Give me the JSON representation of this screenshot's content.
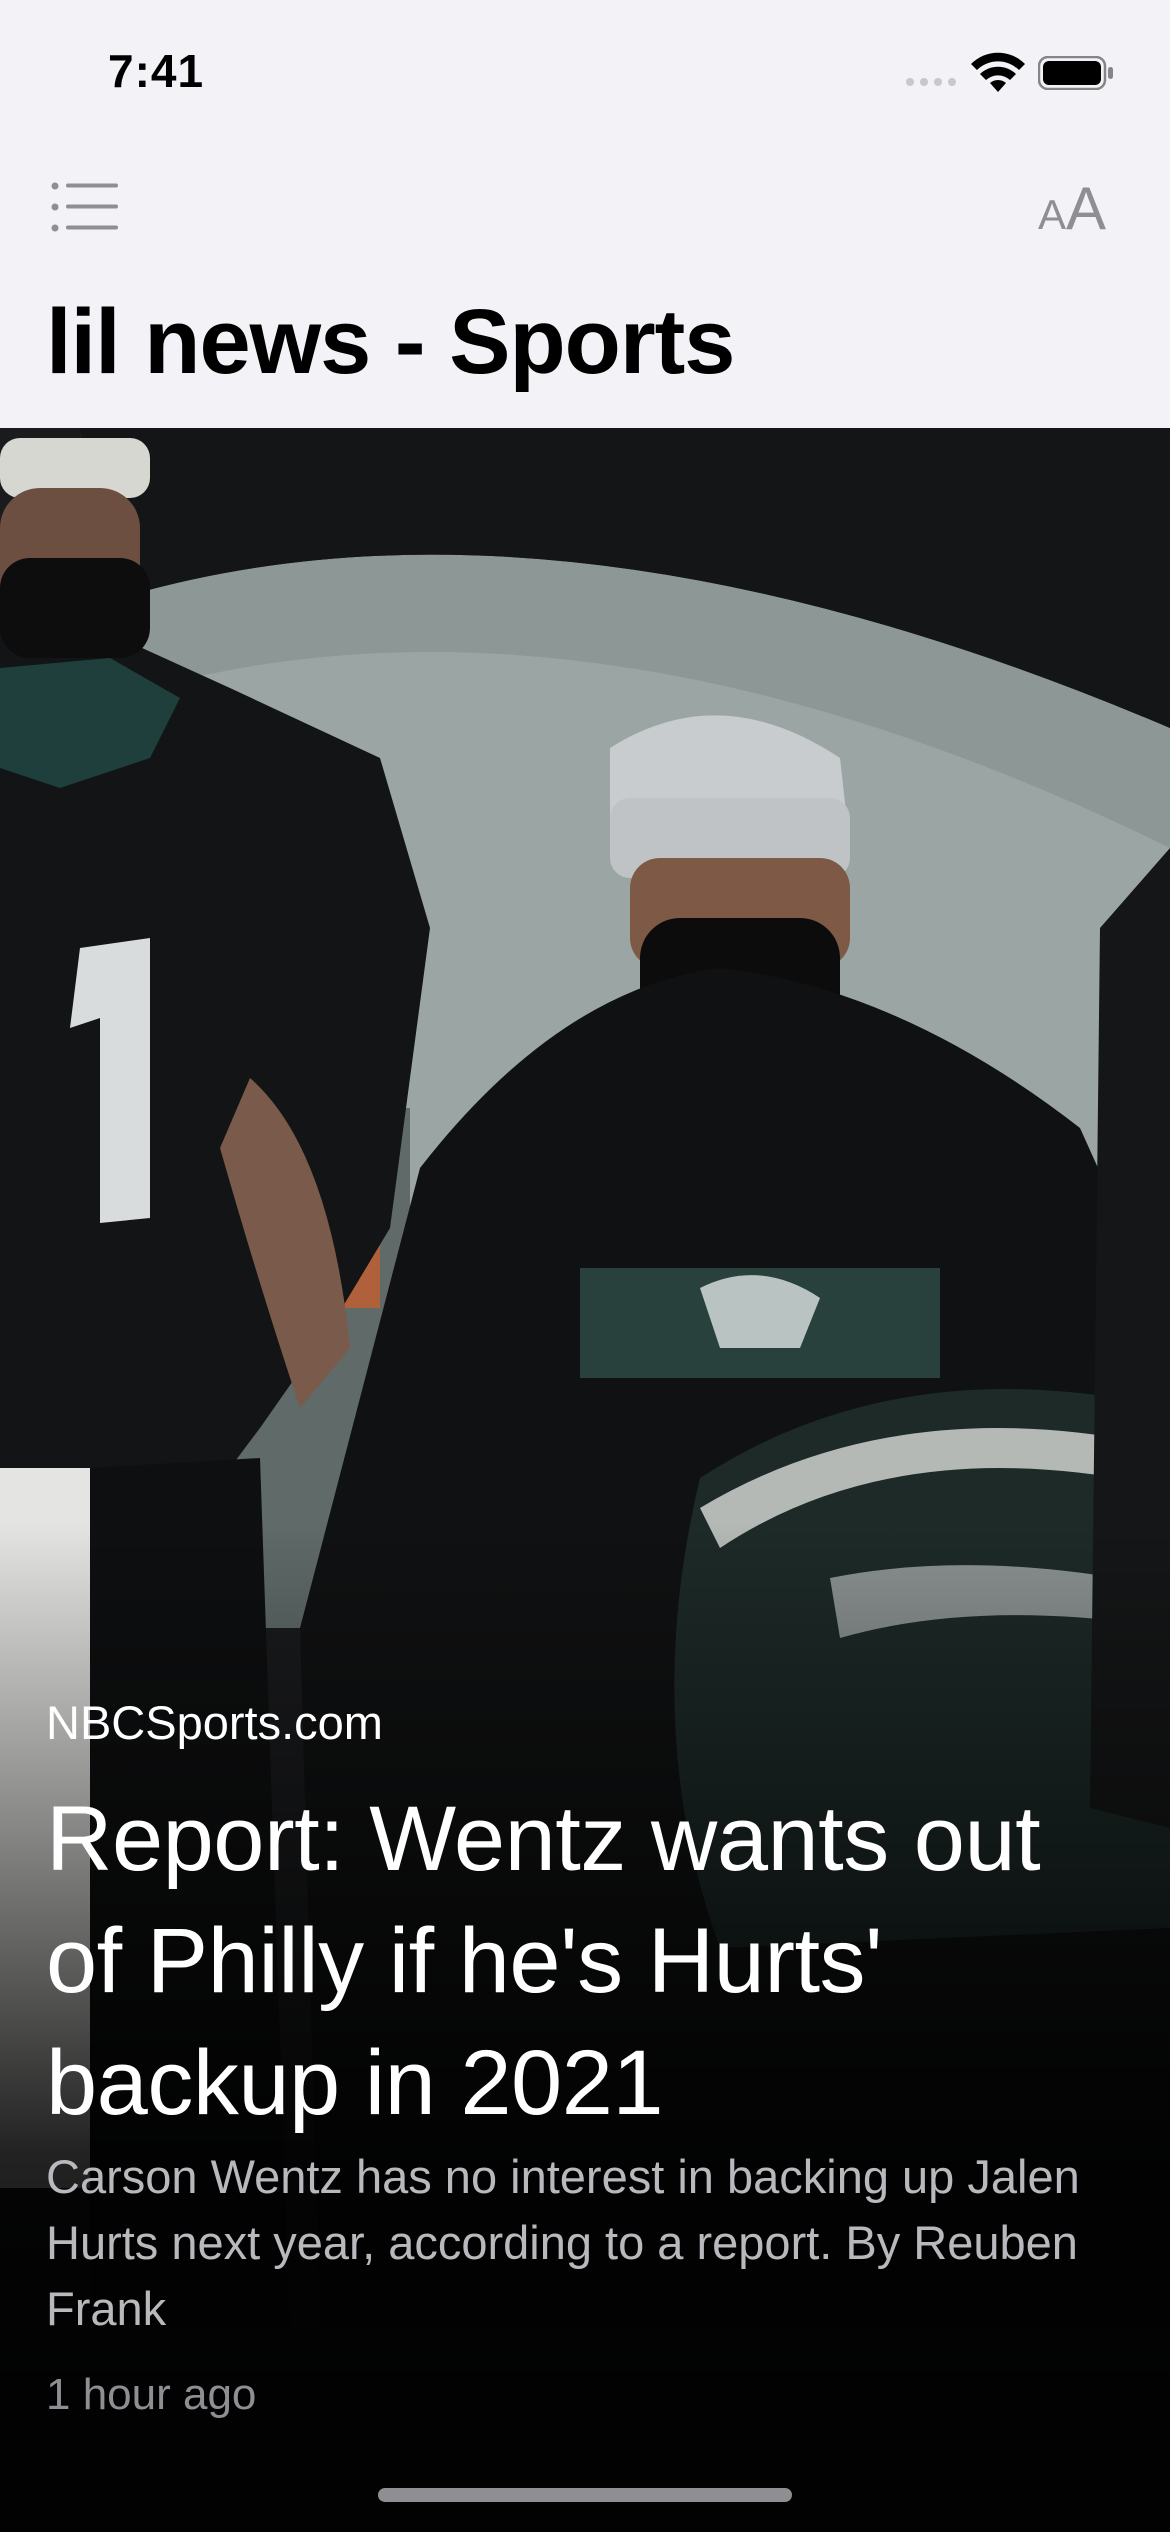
{
  "status_bar": {
    "time": "7:41",
    "icons": [
      "signal-icon",
      "wifi-icon",
      "battery-icon"
    ]
  },
  "nav": {
    "menu_icon": "list-menu-icon",
    "text_size_icon": "text-size-icon",
    "text_size_small": "A",
    "text_size_big": "A",
    "title": "lil news - Sports"
  },
  "article": {
    "image": "photo of a quarterback in a #1 jersey and a coach wearing black face masks and caps",
    "source": "NBCSports.com",
    "headline": "Report: Wentz wants out of Philly if he's Hurts' backup in 2021",
    "summary": "Carson Wentz has no interest in backing up Jalen Hurts next year, according to a report. By Reuben Frank",
    "time_ago": "1 hour ago"
  },
  "colors": {
    "background": "#f2f2f7",
    "title": "#000000",
    "icon_gray": "#8e8e93",
    "headline": "#ffffff",
    "summary": "#b8b8bd"
  }
}
